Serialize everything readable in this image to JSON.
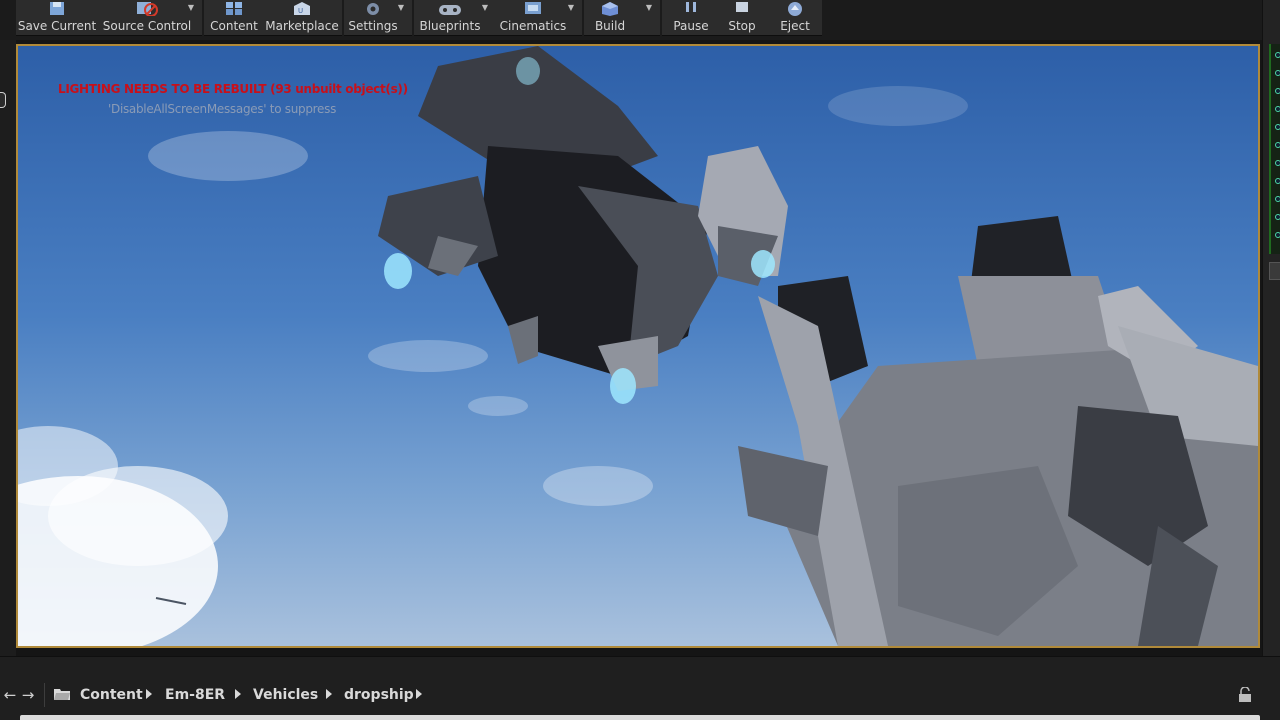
{
  "toolbar": {
    "buttons": [
      {
        "label": "Save Current",
        "icon": "save-icon"
      },
      {
        "label": "Source Control",
        "icon": "source-control-icon"
      },
      {
        "label": "Content",
        "icon": "content-icon"
      },
      {
        "label": "Marketplace",
        "icon": "marketplace-icon"
      },
      {
        "label": "Settings",
        "icon": "settings-icon"
      },
      {
        "label": "Blueprints",
        "icon": "blueprints-icon"
      },
      {
        "label": "Cinematics",
        "icon": "cinematics-icon"
      },
      {
        "label": "Build",
        "icon": "build-icon"
      },
      {
        "label": "Pause",
        "icon": "pause-icon"
      },
      {
        "label": "Stop",
        "icon": "stop-icon"
      },
      {
        "label": "Eject",
        "icon": "eject-icon"
      }
    ]
  },
  "viewport": {
    "warning": "LIGHTING NEEDS TO BE REBUILT (93 unbuilt object(s))",
    "suppress_hint": "'DisableAllScreenMessages' to suppress"
  },
  "breadcrumb": {
    "items": [
      "Content",
      "Em-8ER",
      "Vehicles",
      "dropship"
    ]
  },
  "colors": {
    "warning_red": "#c8101a",
    "viewport_border": "#b08a3a",
    "panel_bg": "#2c2c2c"
  }
}
